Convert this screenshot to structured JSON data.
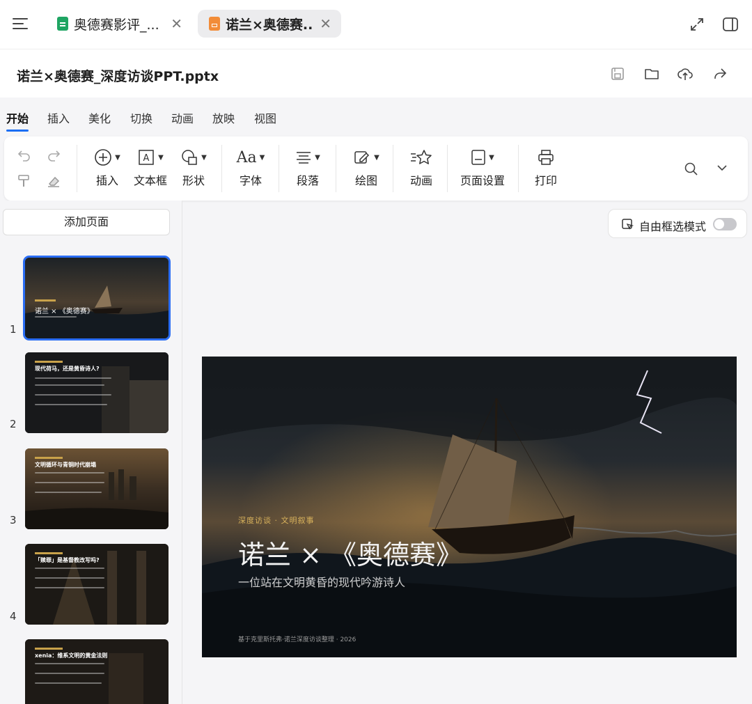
{
  "tabs": [
    {
      "title": "奥德赛影评_...",
      "type": "sheet"
    },
    {
      "title": "诺兰×奥德赛...",
      "type": "ppt",
      "active": true
    }
  ],
  "doc": {
    "title": "诺兰×奥德赛_深度访谈PPT.pptx"
  },
  "ribbon_tabs": [
    "开始",
    "插入",
    "美化",
    "切换",
    "动画",
    "放映",
    "视图"
  ],
  "toolbar": {
    "insert": "插入",
    "textbox": "文本框",
    "shape": "形状",
    "font": "字体",
    "paragraph": "段落",
    "draw": "绘图",
    "animation": "动画",
    "page_setup": "页面设置",
    "print": "打印"
  },
  "left_panel": {
    "add_page": "添加页面",
    "slides": [
      {
        "num": "1",
        "title": "诺兰 × 《奥德赛》"
      },
      {
        "num": "2",
        "title": "现代荷马，还是黄昏诗人?"
      },
      {
        "num": "3",
        "title": "文明循环与青铜时代崩塌"
      },
      {
        "num": "4",
        "title": "「赎罪」是基督教改写吗?"
      },
      {
        "num": "",
        "title": "xenia：维系文明的黄金法则"
      }
    ]
  },
  "free_select": {
    "label": "自由框选模式",
    "enabled": false
  },
  "slide": {
    "tag": "深度访谈 · 文明叙事",
    "title": "诺兰 × 《奥德赛》",
    "subtitle": "一位站在文明黄昏的现代吟游诗人",
    "footer": "基于克里斯托弗·诺兰深度访谈整理 · 2026"
  },
  "colors": {
    "accent": "#1b6ef3",
    "gold": "#d8b25c",
    "sheet_icon": "#1fa563",
    "ppt_icon": "#f28c38"
  }
}
